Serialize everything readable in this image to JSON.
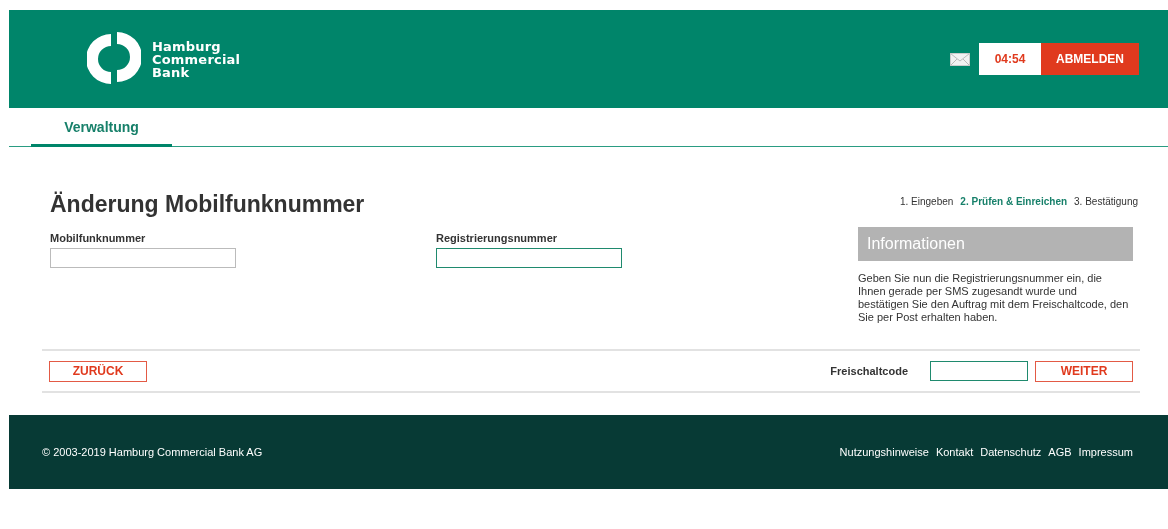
{
  "header": {
    "logo_lines": [
      "Hamburg",
      "Commercial",
      "Bank"
    ],
    "timer": "04:54",
    "logout": "ABMELDEN"
  },
  "tabs": [
    {
      "label": "Verwaltung",
      "selected": true
    }
  ],
  "page": {
    "title": "Änderung Mobilfunknummer",
    "steps": [
      {
        "label": "1. Eingeben",
        "selected": false
      },
      {
        "label": "2. Prüfen & Einreichen",
        "selected": true
      },
      {
        "label": "3. Bestätigung",
        "selected": false
      }
    ],
    "fields": [
      {
        "label": "Mobilfunknummer",
        "focused": false
      },
      {
        "label": "Registrierungsnummer",
        "focused": true
      }
    ],
    "info": {
      "title": "Informationen",
      "text": "Geben Sie nun die Registrierungsnummer ein, die Ihnen gerade per SMS zugesandt wurde und bestätigen Sie den Auftrag mit dem Freischaltcode, den Sie per Post erhalten haben."
    }
  },
  "actions": {
    "back": "ZURÜCK",
    "code_label": "Freischaltcode",
    "code_focused": true,
    "next": "WEITER"
  },
  "footer": {
    "copyright": "© 2003-2019 Hamburg Commercial Bank AG",
    "links": [
      "Nutzungshinweise",
      "Kontakt",
      "Datenschutz",
      "AGB",
      "Impressum"
    ]
  }
}
